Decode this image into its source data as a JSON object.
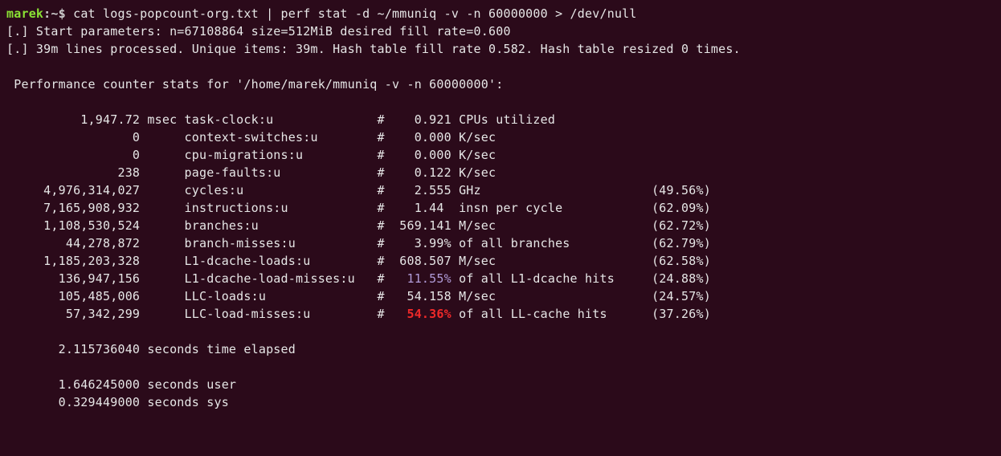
{
  "prompt": {
    "user": "marek",
    "sep": ":~$ "
  },
  "command": "cat logs-popcount-org.txt | perf stat -d ~/mmuniq -v -n 60000000 > /dev/null",
  "preamble": [
    "[.] Start parameters: n=67108864 size=512MiB desired fill rate=0.600",
    "[.] 39m lines processed. Unique items: 39m. Hash table fill rate 0.582. Hash table resized 0 times."
  ],
  "header": " Performance counter stats for '/home/marek/mmuniq -v -n 60000000':",
  "rows": [
    {
      "value": "          1,947.72",
      "unit": " msec ",
      "name": "task-clock:u              ",
      "sep": "#",
      "num": "    0.921 ",
      "desc": "CPUs utilized           ",
      "pct": "",
      "cls": ""
    },
    {
      "value": "                 0",
      "unit": "      ",
      "name": "context-switches:u        ",
      "sep": "#",
      "num": "    0.000 ",
      "desc": "K/sec                   ",
      "pct": "",
      "cls": ""
    },
    {
      "value": "                 0",
      "unit": "      ",
      "name": "cpu-migrations:u          ",
      "sep": "#",
      "num": "    0.000 ",
      "desc": "K/sec                   ",
      "pct": "",
      "cls": ""
    },
    {
      "value": "               238",
      "unit": "      ",
      "name": "page-faults:u             ",
      "sep": "#",
      "num": "    0.122 ",
      "desc": "K/sec                   ",
      "pct": "",
      "cls": ""
    },
    {
      "value": "     4,976,314,027",
      "unit": "      ",
      "name": "cycles:u                  ",
      "sep": "#",
      "num": "    2.555 ",
      "desc": "GHz                     ",
      "pct": "  (49.56%)",
      "cls": ""
    },
    {
      "value": "     7,165,908,932",
      "unit": "      ",
      "name": "instructions:u            ",
      "sep": "#",
      "num": "    1.44  ",
      "desc": "insn per cycle          ",
      "pct": "  (62.09%)",
      "cls": ""
    },
    {
      "value": "     1,108,530,524",
      "unit": "      ",
      "name": "branches:u                ",
      "sep": "#",
      "num": "  569.141 ",
      "desc": "M/sec                   ",
      "pct": "  (62.72%)",
      "cls": ""
    },
    {
      "value": "        44,278,872",
      "unit": "      ",
      "name": "branch-misses:u           ",
      "sep": "#",
      "num": "    3.99% ",
      "desc": "of all branches         ",
      "pct": "  (62.79%)",
      "cls": ""
    },
    {
      "value": "     1,185,203,328",
      "unit": "      ",
      "name": "L1-dcache-loads:u         ",
      "sep": "#",
      "num": "  608.507 ",
      "desc": "M/sec                   ",
      "pct": "  (62.58%)",
      "cls": ""
    },
    {
      "value": "       136,947,156",
      "unit": "      ",
      "name": "L1-dcache-load-misses:u   ",
      "sep": "#",
      "num": "   11.55% ",
      "desc": "of all L1-dcache hits   ",
      "pct": "  (24.88%)",
      "cls": "muted"
    },
    {
      "value": "       105,485,006",
      "unit": "      ",
      "name": "LLC-loads:u               ",
      "sep": "#",
      "num": "   54.158 ",
      "desc": "M/sec                   ",
      "pct": "  (24.57%)",
      "cls": ""
    },
    {
      "value": "        57,342,299",
      "unit": "      ",
      "name": "LLC-load-misses:u         ",
      "sep": "#",
      "num": "   54.36% ",
      "desc": "of all LL-cache hits    ",
      "pct": "  (37.26%)",
      "cls": "danger"
    }
  ],
  "elapsed": "       2.115736040 seconds time elapsed",
  "user_time": "       1.646245000 seconds user",
  "sys_time": "       0.329449000 seconds sys"
}
